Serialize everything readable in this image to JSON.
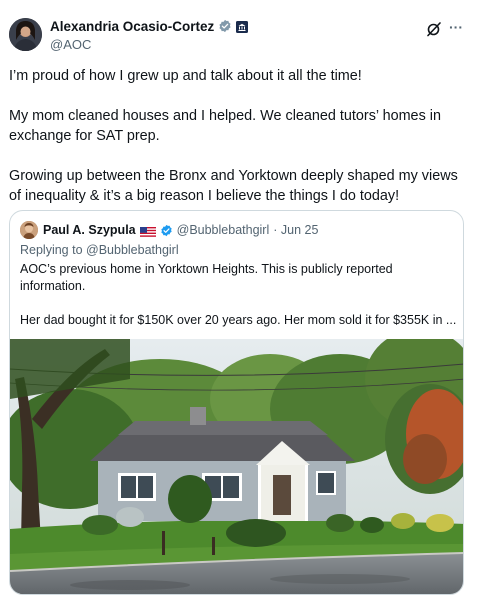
{
  "post": {
    "author_name": "Alexandria Ocasio-Cortez",
    "author_handle": "@AOC",
    "paragraphs": [
      "I’m proud of how I grew up and talk about it all the time!",
      "My mom cleaned houses and I helped. We cleaned tutors’ homes in exchange for SAT prep.",
      "Growing up between the Bronx and Yorktown deeply shaped my views of inequality & it’s a big reason I believe the things I do today!"
    ],
    "more_glyph": "···"
  },
  "quoted": {
    "author_name": "Paul A. Szypula",
    "author_handle": "@Bubblebathgirl",
    "date": "· Jun 25",
    "replying_to": "Replying to @Bubblebathgirl",
    "paragraphs": [
      "AOC’s previous home in Yorktown Heights. This is publicly reported information.",
      "Her dad bought it for $150K over 20 years ago. Her mom sold it for $355K in ..."
    ],
    "photo_icon": "house-photo"
  },
  "colors": {
    "text_primary": "#0f1419",
    "text_secondary": "#536471",
    "verified_blue": "#1d9bf0",
    "border": "#cfd9de"
  },
  "icons": {
    "verified": "verified-badge-icon",
    "government": "government-badge-icon",
    "grok": "grok-icon",
    "more": "more-icon",
    "flag": "us-flag-icon"
  }
}
